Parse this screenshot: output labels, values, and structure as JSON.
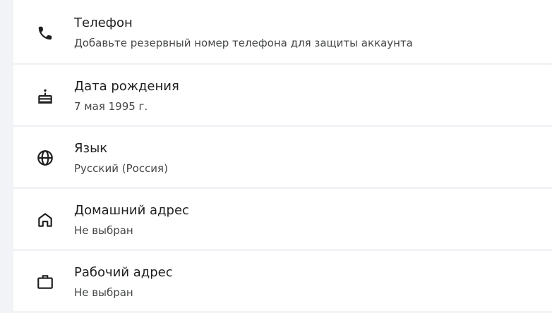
{
  "items": [
    {
      "icon": "phone-icon",
      "title": "Телефон",
      "subtitle": "Добавьте резервный номер телефона для защиты аккаунта"
    },
    {
      "icon": "cake-icon",
      "title": "Дата рождения",
      "subtitle": "7 мая 1995 г."
    },
    {
      "icon": "globe-icon",
      "title": "Язык",
      "subtitle": "Русский (Россия)"
    },
    {
      "icon": "home-icon",
      "title": "Домашний адрес",
      "subtitle": "Не выбран"
    },
    {
      "icon": "briefcase-icon",
      "title": "Рабочий адрес",
      "subtitle": "Не выбран"
    }
  ],
  "colors": {
    "background": "#f1f3f6",
    "card": "#ffffff",
    "title": "#1f1f1f",
    "subtitle": "#444746",
    "icon": "#1f1f1f"
  }
}
